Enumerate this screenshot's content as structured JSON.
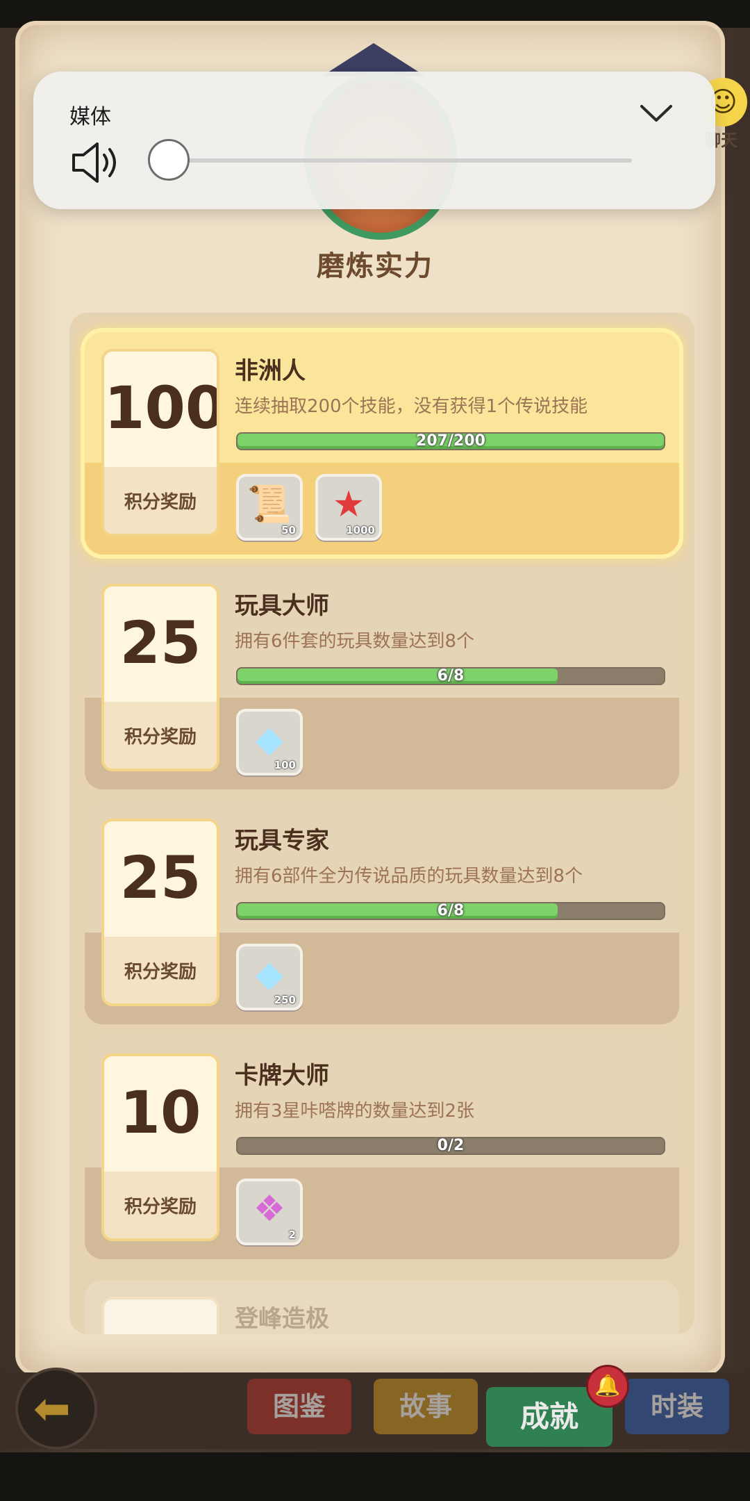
{
  "media": {
    "label": "媒体",
    "volume_level": 0
  },
  "page": {
    "title": "磨炼实力",
    "side_chat_label": "聊天"
  },
  "achievements": [
    {
      "title": "非洲人",
      "description": "连续抽取200个技能，没有获得1个传说技能",
      "points": "100",
      "points_label": "积分奖励",
      "progress_text": "207/200",
      "progress_fraction": 1.0,
      "highlight": true,
      "rewards": [
        {
          "icon": "scroll-icon",
          "qty": "50"
        },
        {
          "icon": "starfish-icon",
          "qty": "1000"
        }
      ]
    },
    {
      "title": "玩具大师",
      "description": "拥有6件套的玩具数量达到8个",
      "points": "25",
      "points_label": "积分奖励",
      "progress_text": "6/8",
      "progress_fraction": 0.75,
      "highlight": false,
      "rewards": [
        {
          "icon": "gem-icon",
          "qty": "100"
        }
      ]
    },
    {
      "title": "玩具专家",
      "description": "拥有6部件全为传说品质的玩具数量达到8个",
      "points": "25",
      "points_label": "积分奖励",
      "progress_text": "6/8",
      "progress_fraction": 0.75,
      "highlight": false,
      "rewards": [
        {
          "icon": "gem-icon",
          "qty": "250"
        }
      ]
    },
    {
      "title": "卡牌大师",
      "description": "拥有3星咔嗒牌的数量达到2张",
      "points": "10",
      "points_label": "积分奖励",
      "progress_text": "0/2",
      "progress_fraction": 0,
      "highlight": false,
      "rewards": [
        {
          "icon": "card-icon",
          "qty": "2"
        }
      ]
    }
  ],
  "peek_card_title": "登峰造极",
  "nav": {
    "back_icon": "back-arrow-icon",
    "atlas": "图鉴",
    "story": "故事",
    "achievements": "成就",
    "costume": "时装",
    "bell_icon": "bell-icon"
  }
}
